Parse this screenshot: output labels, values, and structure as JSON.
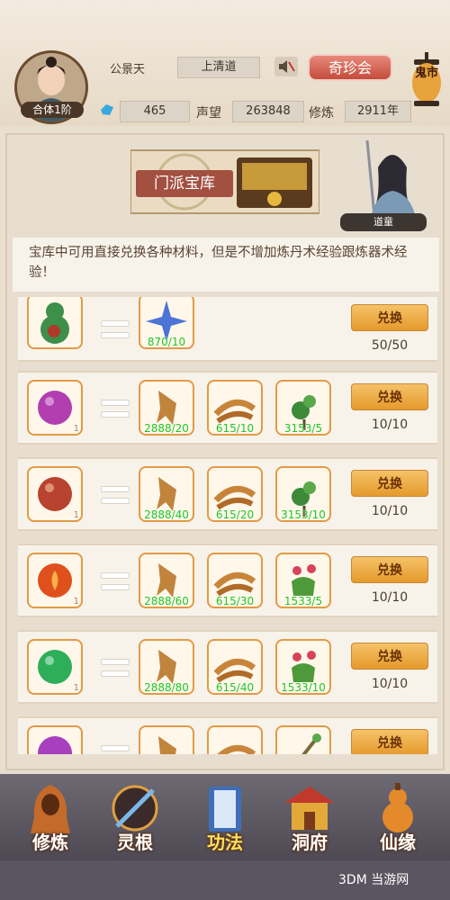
{
  "player": {
    "name": "公景天",
    "sect": "上清道",
    "realm": "合体1阶",
    "spirit_stones": "465",
    "reputation_label": "声望",
    "reputation": "263848",
    "cultivation_label": "修炼",
    "cultivation_years": "2911年"
  },
  "header": {
    "treasure_button": "奇珍会",
    "lantern_text": "鬼市"
  },
  "banner": {
    "title": "门派宝库",
    "npc_name": "道童"
  },
  "notice": "宝库中可用直接兑换各种材料，但是不增加炼丹术经验跟炼器术经验！",
  "exchange_label": "兑换",
  "rows": [
    {
      "result_icon": "gourd-icon",
      "result_color": "#3e8f4a",
      "materials": [
        {
          "icon": "star-crystal-icon",
          "count": "870/10"
        }
      ],
      "limit": "50/50"
    },
    {
      "result_icon": "purple-pearl-icon",
      "result_color": "#b23fb0",
      "materials": [
        {
          "icon": "ginseng-icon",
          "count": "2888/20"
        },
        {
          "icon": "cordyceps-icon",
          "count": "615/10"
        },
        {
          "icon": "herb-icon",
          "count": "3153/5"
        }
      ],
      "limit": "10/10"
    },
    {
      "result_icon": "red-pearl-icon",
      "result_color": "#b8432e",
      "materials": [
        {
          "icon": "ginseng-icon",
          "count": "2888/40"
        },
        {
          "icon": "cordyceps-icon",
          "count": "615/20"
        },
        {
          "icon": "herb-icon",
          "count": "3153/10"
        }
      ],
      "limit": "10/10"
    },
    {
      "result_icon": "fire-pearl-icon",
      "result_color": "#e0501c",
      "materials": [
        {
          "icon": "ginseng-icon",
          "count": "2888/60"
        },
        {
          "icon": "cordyceps-icon",
          "count": "615/30"
        },
        {
          "icon": "flower-herb-icon",
          "count": "1533/5"
        }
      ],
      "limit": "10/10"
    },
    {
      "result_icon": "green-pearl-icon",
      "result_color": "#2fae5a",
      "materials": [
        {
          "icon": "ginseng-icon",
          "count": "2888/80"
        },
        {
          "icon": "cordyceps-icon",
          "count": "615/40"
        },
        {
          "icon": "flower-herb-icon",
          "count": "1533/10"
        }
      ],
      "limit": "10/10"
    },
    {
      "result_icon": "violet-pearl-icon",
      "result_color": "#a73fbf",
      "materials": [
        {
          "icon": "ginseng-icon",
          "count": ""
        },
        {
          "icon": "cordyceps-icon",
          "count": ""
        },
        {
          "icon": "staff-icon",
          "count": ""
        }
      ],
      "limit": ""
    }
  ],
  "nav": [
    {
      "label": "修炼",
      "icon": "hooded-figure-icon"
    },
    {
      "label": "灵根",
      "icon": "spirit-root-icon"
    },
    {
      "label": "功法",
      "icon": "scroll-book-icon"
    },
    {
      "label": "洞府",
      "icon": "pavilion-icon"
    },
    {
      "label": "仙缘",
      "icon": "gourd-fortune-icon"
    }
  ],
  "watermark": "3DM 当游网"
}
